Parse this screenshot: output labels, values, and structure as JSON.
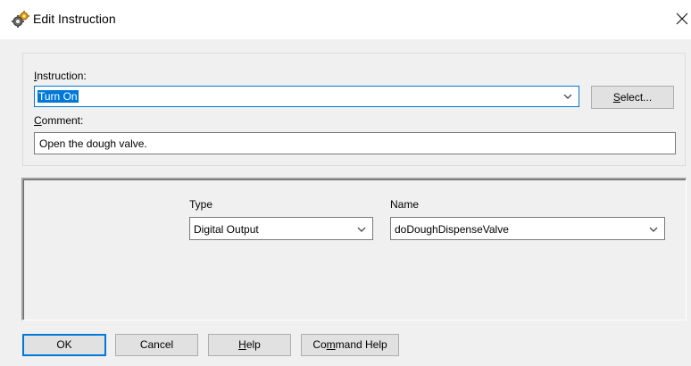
{
  "window": {
    "title": "Edit Instruction",
    "icon": "gears-icon",
    "close_icon": "close-icon"
  },
  "instruction": {
    "label_underline": "I",
    "label_rest": "nstruction:",
    "value": "Turn On",
    "select_button_underline": "S",
    "select_button_rest": "elect..."
  },
  "comment": {
    "label_underline": "C",
    "label_rest": "omment:",
    "value": "Open the dough valve."
  },
  "parameters": {
    "type_label": "Type",
    "type_value": "Digital Output",
    "name_label": "Name",
    "name_value": "doDoughDispenseValve"
  },
  "buttons": {
    "ok": "OK",
    "cancel": "Cancel",
    "help_underline": "H",
    "help_rest": "elp",
    "command_help_prefix": "Co",
    "command_help_underline": "m",
    "command_help_rest": "mand Help"
  },
  "colors": {
    "accent": "#0078d7",
    "background": "#f0f0f0"
  }
}
